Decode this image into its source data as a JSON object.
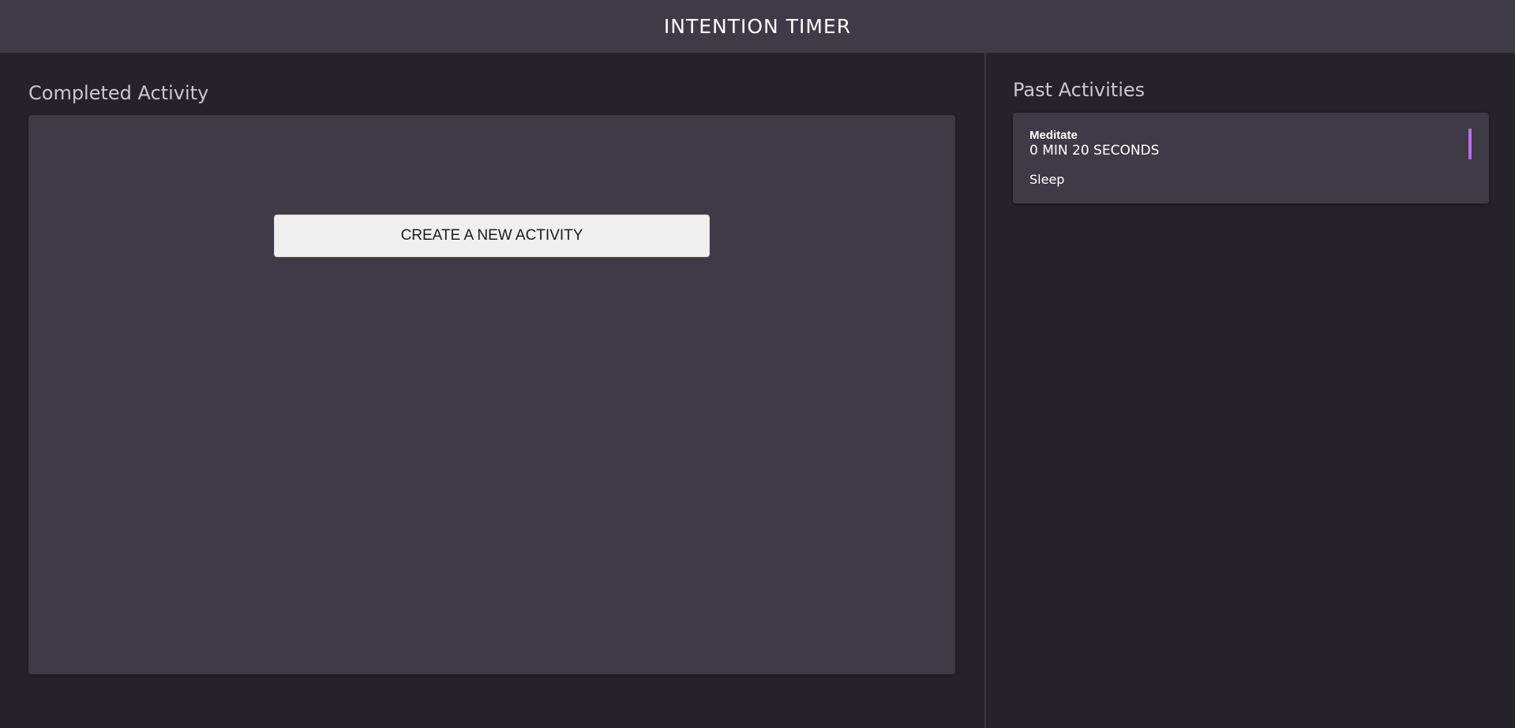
{
  "header": {
    "title": "INTENTION TIMER"
  },
  "completed": {
    "heading": "Completed Activity",
    "create_button_label": "CREATE A NEW ACTIVITY"
  },
  "past": {
    "heading": "Past Activities",
    "activities": [
      {
        "name": "Meditate",
        "duration": "0 MIN 20 SECONDS",
        "category": "Sleep",
        "accent_color": "#b76eea"
      }
    ]
  },
  "colors": {
    "background": "#25222c",
    "surface": "#3e3b46",
    "accent_meditate": "#b76eea"
  }
}
